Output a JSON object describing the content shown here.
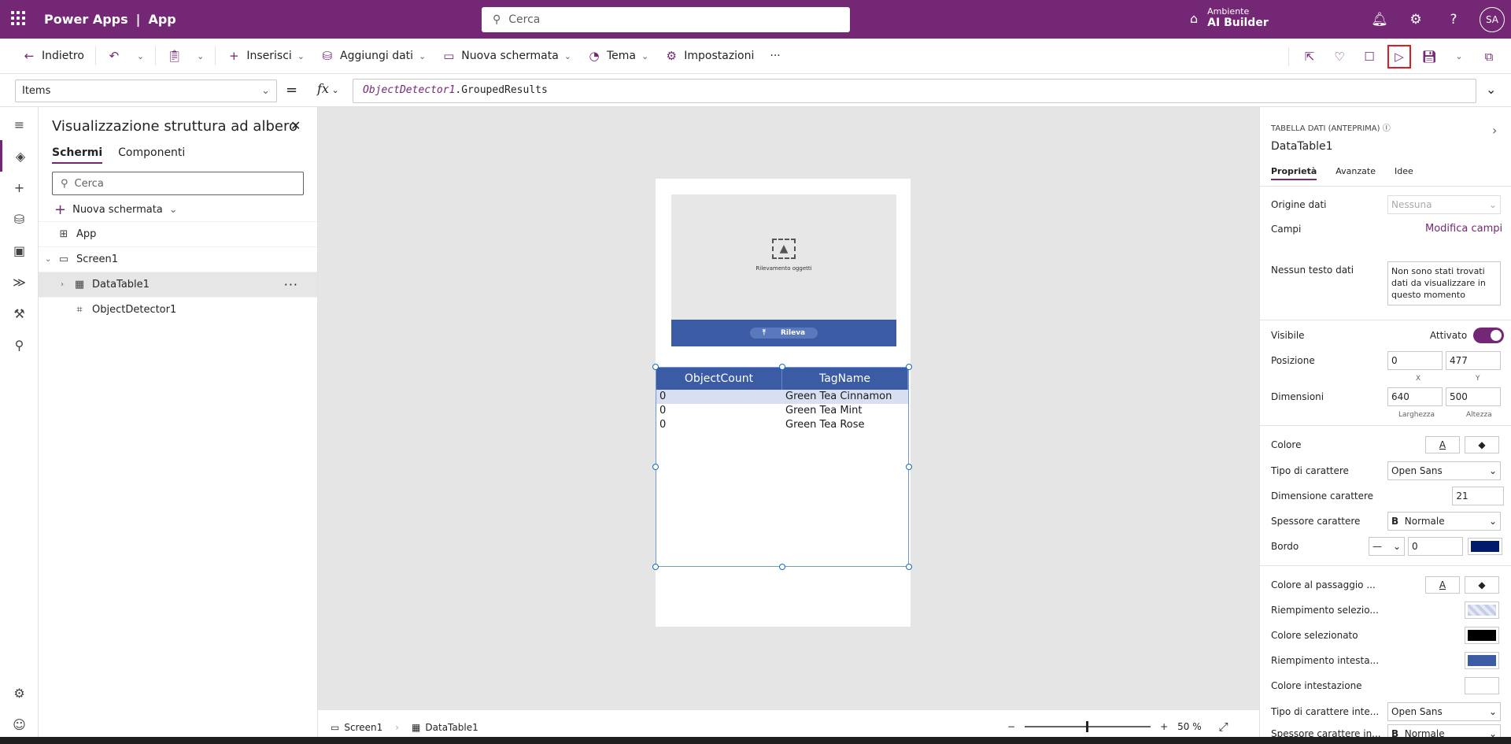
{
  "header": {
    "product": "Power Apps",
    "divider": "|",
    "app_name": "App",
    "search_placeholder": "Cerca",
    "env_label": "Ambiente",
    "env_name": "AI Builder",
    "avatar_initials": "SA"
  },
  "toolbar": {
    "back": "Indietro",
    "insert": "Inserisci",
    "add_data": "Aggiungi dati",
    "new_screen": "Nuova schermata",
    "theme": "Tema",
    "settings": "Impostazioni",
    "more": "···"
  },
  "formula_bar": {
    "property": "Items",
    "equals": "=",
    "fx": "fx",
    "control": "ObjectDetector1",
    "member": ".GroupedResults"
  },
  "tree": {
    "title": "Visualizzazione struttura ad albero",
    "tabs": [
      "Schermi",
      "Componenti"
    ],
    "search_placeholder": "Cerca",
    "new_screen": "Nuova schermata",
    "items": [
      {
        "label": "App"
      },
      {
        "label": "Screen1"
      },
      {
        "label": "DataTable1"
      },
      {
        "label": "ObjectDetector1"
      }
    ]
  },
  "canvas": {
    "detector_label": "Rilevamento oggetti",
    "detect_button": "Rileva",
    "table": {
      "columns": [
        "ObjectCount",
        "TagName"
      ],
      "rows": [
        [
          "0",
          "Green Tea Cinnamon"
        ],
        [
          "0",
          "Green Tea Mint"
        ],
        [
          "0",
          "Green Tea Rose"
        ]
      ]
    }
  },
  "footer": {
    "crumbs": [
      "Screen1",
      "DataTable1"
    ],
    "zoom_value": "50",
    "zoom_unit": "%",
    "zoom_level": 0.5
  },
  "properties": {
    "kind": "TABELLA DATI (ANTEPRIMA)",
    "name": "DataTable1",
    "tabs": [
      "Proprietà",
      "Avanzate",
      "Idee"
    ],
    "data_source_label": "Origine dati",
    "data_source_value": "Nessuna",
    "fields_label": "Campi",
    "fields_link": "Modifica campi",
    "no_data_label": "Nessun testo dati",
    "no_data_value": "Non sono stati trovati dati da visualizzare in questo momento",
    "visible_label": "Visibile",
    "visible_value": "Attivato",
    "position_label": "Posizione",
    "pos_x": "0",
    "pos_y": "477",
    "x_label": "X",
    "y_label": "Y",
    "size_label": "Dimensioni",
    "width": "640",
    "height": "500",
    "width_label": "Larghezza",
    "height_label": "Altezza",
    "color_label": "Colore",
    "font_label": "Tipo di carattere",
    "font_value": "Open Sans",
    "font_size_label": "Dimensione carattere",
    "font_size_value": "21",
    "font_weight_label": "Spessore carattere",
    "font_weight_value": "Normale",
    "border_label": "Bordo",
    "border_value": "0",
    "hover_color_label": "Colore al passaggio ...",
    "selection_fill_label": "Riempimento selezio...",
    "selected_color_label": "Colore selezionato",
    "header_fill_label": "Riempimento intesta...",
    "header_color_label": "Colore intestazione",
    "header_font_label": "Tipo di carattere inte...",
    "header_font_value": "Open Sans",
    "header_weight_label": "Spessore carattere in...",
    "header_weight_value": "Normale"
  },
  "colors": {
    "brand": "#742774",
    "header_fill": "#3b5ba5",
    "border_color": "#001a6e",
    "selected_color": "#000000",
    "run_highlight": "#e01b24"
  }
}
